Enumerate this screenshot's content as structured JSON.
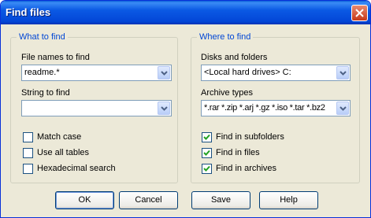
{
  "window": {
    "title": "Find files"
  },
  "what_to_find": {
    "legend": "What to find",
    "file_names_label": "File names to find",
    "file_names_value": "readme.*",
    "string_label": "String to find",
    "string_value": "",
    "options": [
      {
        "label": "Match case",
        "checked": false
      },
      {
        "label": "Use all tables",
        "checked": false
      },
      {
        "label": "Hexadecimal search",
        "checked": false
      }
    ]
  },
  "where_to_find": {
    "legend": "Where to find",
    "disks_label": "Disks and folders",
    "disks_value": "<Local hard drives> C:",
    "archive_label": "Archive types",
    "archive_value": "*.rar *.zip *.arj *.gz *.iso *.tar *.bz2",
    "options": [
      {
        "label": "Find in subfolders",
        "checked": true
      },
      {
        "label": "Find in files",
        "checked": true
      },
      {
        "label": "Find in archives",
        "checked": true
      }
    ]
  },
  "buttons": {
    "ok": "OK",
    "cancel": "Cancel",
    "save": "Save",
    "help": "Help"
  },
  "icons": {
    "close": "close-icon",
    "dropdown": "chevron-down-icon",
    "check": "checkmark-icon"
  }
}
